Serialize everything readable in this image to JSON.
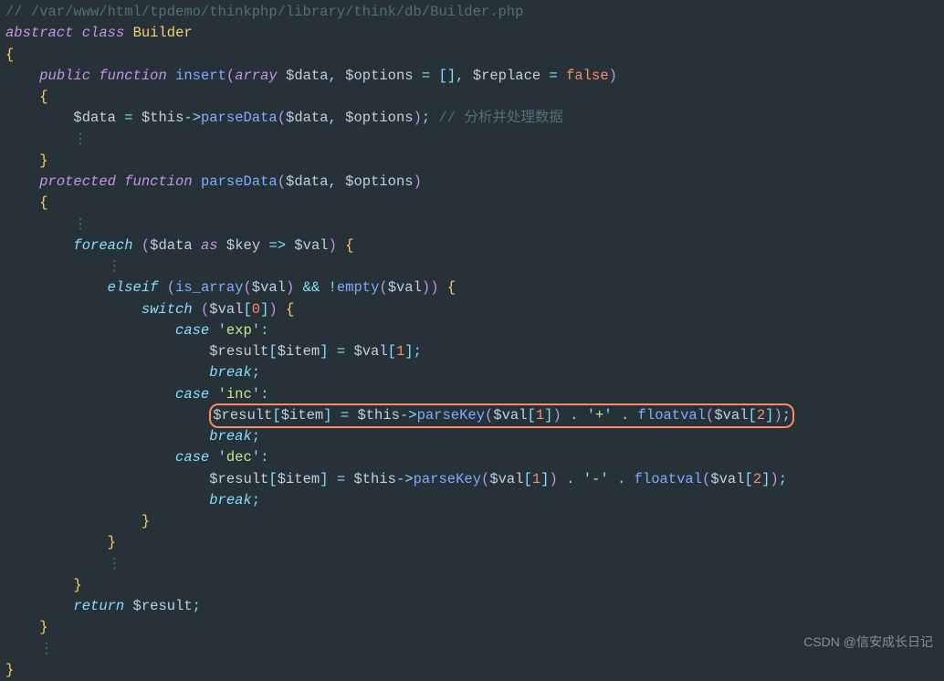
{
  "file_path_comment": "// /var/www/html/tpdemo/thinkphp/library/think/db/Builder.php",
  "declaration": {
    "abstract": "abstract",
    "class": "class",
    "name": "Builder"
  },
  "braces": {
    "open": "{",
    "close": "}"
  },
  "insert_fn": {
    "visibility": "public",
    "function": "function",
    "name": "insert",
    "param_array": "array",
    "param_data": "$data",
    "param_options": "$options",
    "default_options": "[]",
    "param_replace": "$replace",
    "default_replace": "false",
    "body_assign_lhs": "$data",
    "body_assign_this": "$this",
    "body_assign_fn": "parseData",
    "comment": "// 分析并处理数据"
  },
  "parseData_fn": {
    "visibility": "protected",
    "function": "function",
    "name": "parseData",
    "param_data": "$data",
    "param_options": "$options"
  },
  "foreach": {
    "kw": "foreach",
    "arr": "$data",
    "as": "as",
    "key": "$key",
    "arrow": "=>",
    "val": "$val"
  },
  "elseif": {
    "kw": "elseif",
    "is_array": "is_array",
    "empty": "empty",
    "val": "$val",
    "amp": "&&",
    "bang": "!"
  },
  "switch": {
    "kw": "switch",
    "val": "$val",
    "idx": "0"
  },
  "case_exp": {
    "kw": "case",
    "label": "exp",
    "result": "$result",
    "item": "$item",
    "val": "$val",
    "idx": "1",
    "break": "break"
  },
  "case_inc": {
    "kw": "case",
    "label": "inc",
    "result": "$result",
    "item": "$item",
    "this": "$this",
    "parseKey": "parseKey",
    "val": "$val",
    "idx1": "1",
    "plus": "+",
    "floatval": "floatval",
    "idx2": "2",
    "break": "break"
  },
  "case_dec": {
    "kw": "case",
    "label": "dec",
    "result": "$result",
    "item": "$item",
    "this": "$this",
    "parseKey": "parseKey",
    "val": "$val",
    "idx1": "1",
    "minus": "-",
    "floatval": "floatval",
    "idx2": "2",
    "break": "break"
  },
  "return": {
    "kw": "return",
    "val": "$result"
  },
  "ellipsis": "⋮",
  "watermark": "CSDN @信安成长日记"
}
